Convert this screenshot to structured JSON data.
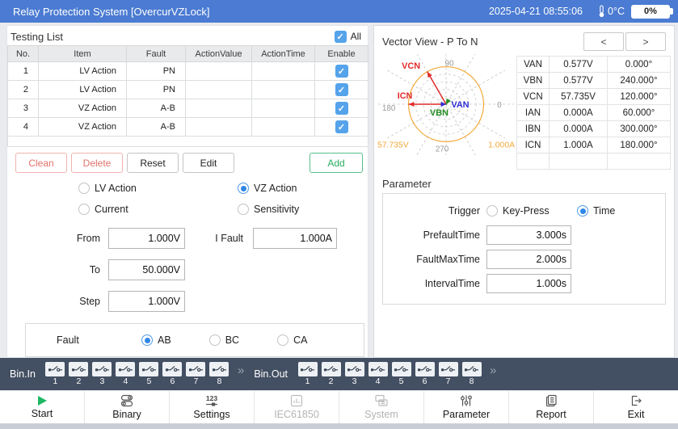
{
  "title_bar": {
    "title": "Relay Protection System [OvercurVZLock]",
    "datetime": "2025-04-21 08:55:06",
    "temperature": "0°C",
    "battery": "0%"
  },
  "testing_list": {
    "label": "Testing List",
    "all_label": "All",
    "check_glyph": "✓",
    "columns": [
      "No.",
      "Item",
      "Fault",
      "ActionValue",
      "ActionTime",
      "Enable"
    ],
    "rows": [
      {
        "no": "1",
        "item": "LV Action",
        "fault": "PN",
        "action_value": "",
        "action_time": "",
        "enabled": true
      },
      {
        "no": "2",
        "item": "LV Action",
        "fault": "PN",
        "action_value": "",
        "action_time": "",
        "enabled": true
      },
      {
        "no": "3",
        "item": "VZ Action",
        "fault": "A-B",
        "action_value": "",
        "action_time": "",
        "enabled": true
      },
      {
        "no": "4",
        "item": "VZ Action",
        "fault": "A-B",
        "action_value": "",
        "action_time": "",
        "enabled": true
      }
    ],
    "buttons": {
      "clean": "Clean",
      "delete": "Delete",
      "reset": "Reset",
      "edit": "Edit",
      "add": "Add"
    }
  },
  "mode": {
    "options": [
      "LV Action",
      "VZ Action",
      "Current",
      "Sensitivity"
    ],
    "selected": "VZ Action"
  },
  "form": {
    "from_label": "From",
    "from_value": "1.000V",
    "ifault_label": "I Fault",
    "ifault_value": "1.000A",
    "to_label": "To",
    "to_value": "50.000V",
    "step_label": "Step",
    "step_value": "1.000V"
  },
  "fault": {
    "label": "Fault",
    "options": [
      "AB",
      "BC",
      "CA"
    ],
    "selected": "AB"
  },
  "vector_view": {
    "title": "Vector View - P To N",
    "prev_label": "<",
    "next_label": ">",
    "chart": {
      "angle_labels": {
        "top": "90",
        "right": "0",
        "left": "180",
        "bottom": "270"
      },
      "v_scale": "57.735V",
      "i_scale": "1.000A",
      "outer_circle_color": "#f2a93b",
      "vectors": [
        {
          "name": "VCN",
          "color": "#e02b2b",
          "angle_deg": 120,
          "length_frac": 1.0,
          "label_dx": -32,
          "label_dy": -4
        },
        {
          "name": "ICN",
          "color": "#e02b2b",
          "angle_deg": 180,
          "length_frac": 1.0,
          "label_dx": -14,
          "label_dy": -7
        },
        {
          "name": "VAN",
          "color": "#2f2fd8",
          "angle_deg": 0,
          "length_frac": 0.01,
          "label_dx": 6,
          "label_dy": 4
        },
        {
          "name": "VBN",
          "color": "#1e8c1e",
          "angle_deg": 240,
          "length_frac": 0.01,
          "label_dx": -20,
          "label_dy": 14
        }
      ]
    },
    "table": [
      {
        "name": "VAN",
        "mag": "0.577V",
        "ang": "0.000°"
      },
      {
        "name": "VBN",
        "mag": "0.577V",
        "ang": "240.000°"
      },
      {
        "name": "VCN",
        "mag": "57.735V",
        "ang": "120.000°"
      },
      {
        "name": "IAN",
        "mag": "0.000A",
        "ang": "60.000°"
      },
      {
        "name": "IBN",
        "mag": "0.000A",
        "ang": "300.000°"
      },
      {
        "name": "ICN",
        "mag": "1.000A",
        "ang": "180.000°"
      }
    ]
  },
  "parameter": {
    "label": "Parameter",
    "trigger_label": "Trigger",
    "options": [
      "Key-Press",
      "Time"
    ],
    "selected": "Time",
    "fields": [
      {
        "label": "PrefaultTime",
        "value": "3.000s"
      },
      {
        "label": "FaultMaxTime",
        "value": "2.000s"
      },
      {
        "label": "IntervalTime",
        "value": "1.000s"
      }
    ]
  },
  "bin_bar": {
    "in_label": "Bin.In",
    "out_label": "Bin.Out",
    "in_channels": [
      "1",
      "2",
      "3",
      "4",
      "5",
      "6",
      "7",
      "8"
    ],
    "out_channels": [
      "1",
      "2",
      "3",
      "4",
      "5",
      "6",
      "7",
      "8"
    ],
    "more_glyph": "»"
  },
  "toolbar": {
    "items": [
      {
        "label": "Start",
        "icon": "play-icon",
        "enabled": true
      },
      {
        "label": "Binary",
        "icon": "binary-icon",
        "enabled": true
      },
      {
        "label": "Settings",
        "icon": "settings-icon",
        "enabled": true
      },
      {
        "label": "IEC61850",
        "icon": "iec61850-icon",
        "enabled": false
      },
      {
        "label": "System",
        "icon": "system-icon",
        "enabled": false
      },
      {
        "label": "Parameter",
        "icon": "parameter-icon",
        "enabled": true
      },
      {
        "label": "Report",
        "icon": "report-icon",
        "enabled": true
      },
      {
        "label": "Exit",
        "icon": "exit-icon",
        "enabled": true
      }
    ]
  }
}
